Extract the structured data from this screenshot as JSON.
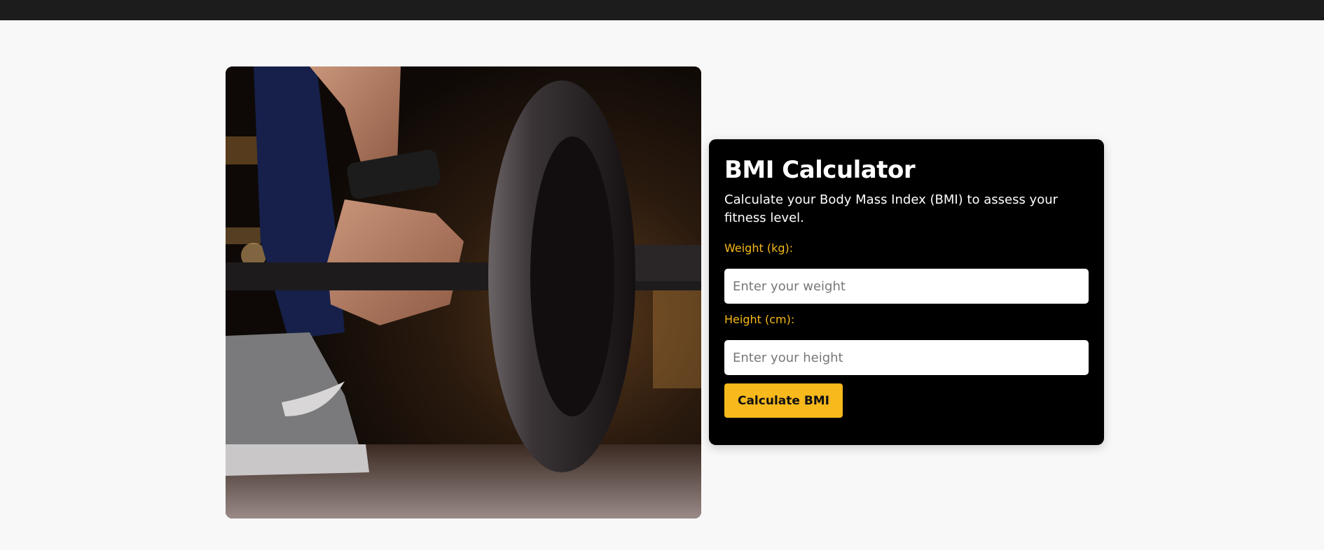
{
  "bmi": {
    "title": "BMI Calculator",
    "description": "Calculate your Body Mass Index (BMI) to assess your fitness level.",
    "weight": {
      "label": "Weight (kg):",
      "placeholder": "Enter your weight",
      "value": ""
    },
    "height": {
      "label": "Height (cm):",
      "placeholder": "Enter your height",
      "value": ""
    },
    "button_label": "Calculate BMI"
  },
  "colors": {
    "accent": "#f7b91c",
    "card_background": "#000000",
    "page_background": "#f8f8f8",
    "topbar": "#1c1c1c"
  }
}
